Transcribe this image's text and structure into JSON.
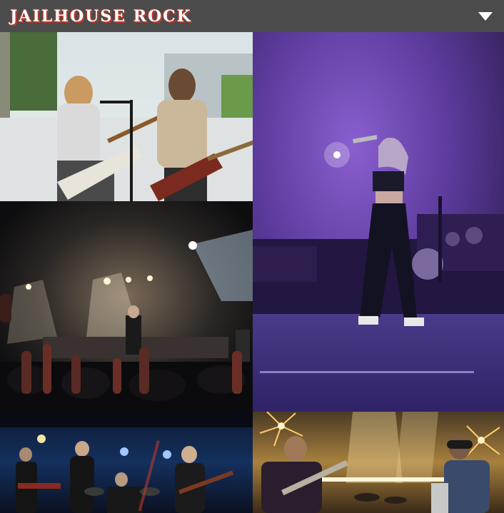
{
  "header": {
    "logo_text": "JAILHOUSE ROCK",
    "menu_icon": "chevron-down-icon"
  },
  "gallery": {
    "photos": [
      {
        "name": "photo-duo-guitarists-outdoor",
        "icon": "image"
      },
      {
        "name": "photo-singer-purple-stage",
        "icon": "image"
      },
      {
        "name": "photo-concert-crowd-hands",
        "icon": "image"
      },
      {
        "name": "photo-band-blue-stage",
        "icon": "image"
      },
      {
        "name": "photo-guitarists-sparklers",
        "icon": "image"
      }
    ]
  },
  "colors": {
    "header_bg": "#4b4b4b",
    "logo_shadow": "#c0392b",
    "purple_stage": "#4b2b8f"
  }
}
